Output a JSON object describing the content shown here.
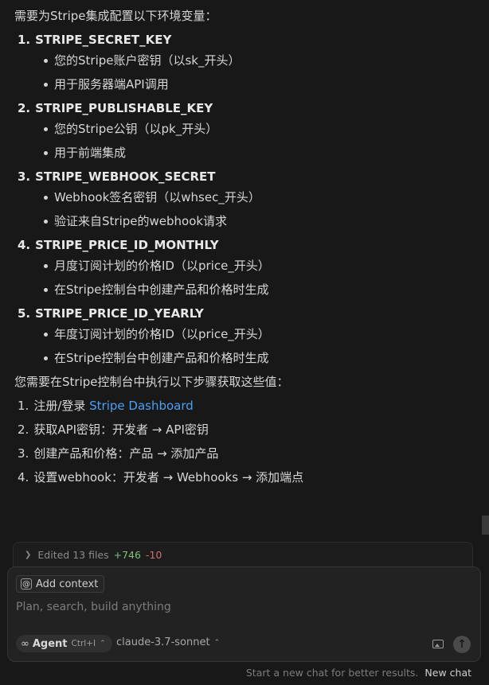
{
  "chat": {
    "intro": "需要为Stripe集成配置以下环境变量：",
    "keys": [
      {
        "num": "1.",
        "title": "STRIPE_SECRET_KEY",
        "bullets": [
          "您的Stripe账户密钥（以sk_开头）",
          "用于服务器端API调用"
        ]
      },
      {
        "num": "2.",
        "title": "STRIPE_PUBLISHABLE_KEY",
        "bullets": [
          "您的Stripe公钥（以pk_开头）",
          "用于前端集成"
        ]
      },
      {
        "num": "3.",
        "title": "STRIPE_WEBHOOK_SECRET",
        "bullets": [
          "Webhook签名密钥（以whsec_开头）",
          "验证来自Stripe的webhook请求"
        ]
      },
      {
        "num": "4.",
        "title": "STRIPE_PRICE_ID_MONTHLY",
        "bullets": [
          "月度订阅计划的价格ID（以price_开头）",
          "在Stripe控制台中创建产品和价格时生成"
        ]
      },
      {
        "num": "5.",
        "title": "STRIPE_PRICE_ID_YEARLY",
        "bullets": [
          "年度订阅计划的价格ID（以price_开头）",
          "在Stripe控制台中创建产品和价格时生成"
        ]
      }
    ],
    "steps_intro": "您需要在Stripe控制台中执行以下步骤获取这些值：",
    "steps": [
      {
        "num": "1.",
        "text": "注册/登录 ",
        "link": "Stripe Dashboard"
      },
      {
        "num": "2.",
        "text": "获取API密钥：开发者 → API密钥"
      },
      {
        "num": "3.",
        "text": "创建产品和价格：产品 → 添加产品"
      },
      {
        "num": "4.",
        "text": "设置webhook：开发者 → Webhooks → 添加端点"
      }
    ]
  },
  "edited": {
    "chevron_icon": "chevron-right-icon",
    "label": "Edited 13 files",
    "added": "+746",
    "removed": "-10"
  },
  "composer": {
    "context_icon": "at-sign-icon",
    "add_context_label": "Add context",
    "placeholder": "Plan, search, build anything",
    "mode_icon": "infinity-icon",
    "mode_label": "Agent",
    "mode_shortcut": "Ctrl+I",
    "model": "claude-3.7-sonnet",
    "image_icon": "image-icon",
    "send_icon": "arrow-up-icon"
  },
  "footer": {
    "hint": "Start a new chat for better results.",
    "new_chat_label": "New chat"
  },
  "colors": {
    "background": "#181818",
    "link": "#4aa0f5",
    "added": "#7cc07c",
    "removed": "#d07070"
  }
}
